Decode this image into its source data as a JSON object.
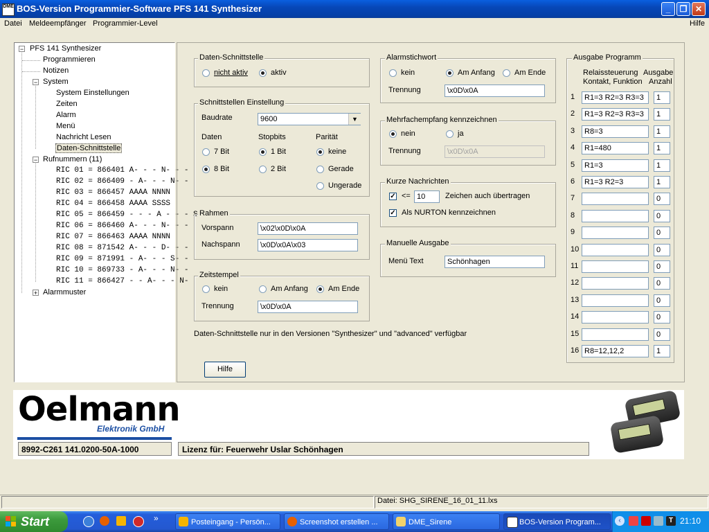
{
  "window": {
    "title": "BOS-Version Programmier-Software PFS 141 Synthesizer",
    "icon": "app-icon",
    "icon_text": "DME"
  },
  "window_controls": {
    "minimize": "_",
    "maximize": "❐",
    "close": "✕"
  },
  "menu": {
    "items": [
      "Datei",
      "Meldeempfänger",
      "Programmier-Level"
    ],
    "help": "Hilfe"
  },
  "tree": {
    "root": "PFS 141 Synthesizer",
    "items": [
      "Programmieren",
      "Notizen"
    ],
    "system": {
      "label": "System",
      "children": [
        "System Einstellungen",
        "Zeiten",
        "Alarm",
        "Menü",
        "Nachricht Lesen",
        "Daten-Schnittstelle"
      ]
    },
    "rufnummern": {
      "label": "Rufnummern (11)",
      "children": [
        "RIC 01 =   866401  A- - -  N- - -",
        "RIC 02 =   866409  - A- -  - N- -",
        "RIC 03 =   866457  AAAA NNNN",
        "RIC 04 =   866458  AAAA SSSS",
        "RIC 05 =   866459  - - - A - - - S",
        "RIC 06 =   866460  A- - -  N- - -",
        "RIC 07 =   866463  AAAA NNNN",
        "RIC 08 =   871542  A- - -  D- - -",
        "RIC 09 =   871991  - A- -  - S- -",
        "RIC 10 =   869733  - A- -  - N- -",
        "RIC 11 =   866427  - - A-  - - N-"
      ]
    },
    "alarmmuster": "Alarmmuster"
  },
  "daten_schnittstelle": {
    "title": "Daten-Schnittstelle",
    "opt1": "nicht aktiv",
    "opt2": "aktiv",
    "selected": "aktiv"
  },
  "schnittstellen": {
    "title": "Schnittstellen Einstellung",
    "baudrate_label": "Baudrate",
    "baudrate": "9600",
    "daten_label": "Daten",
    "daten_opts": [
      "7 Bit",
      "8 Bit"
    ],
    "daten_sel": "8 Bit",
    "stopbits_label": "Stopbits",
    "stopbits_opts": [
      "1 Bit",
      "2 Bit"
    ],
    "stopbits_sel": "1 Bit",
    "paritaet_label": "Parität",
    "paritaet_opts": [
      "keine",
      "Gerade",
      "Ungerade"
    ],
    "paritaet_sel": "keine"
  },
  "rahmen": {
    "title": "Rahmen",
    "vorspann_label": "Vorspann",
    "vorspann": "\\x02\\x0D\\x0A",
    "nachspann_label": "Nachspann",
    "nachspann": "\\x0D\\x0A\\x03"
  },
  "zeitstempel": {
    "title": "Zeitstempel",
    "opts": [
      "kein",
      "Am Anfang",
      "Am Ende"
    ],
    "selected": "Am Ende",
    "trennung_label": "Trennung",
    "trennung": "\\x0D\\x0A"
  },
  "note": "Daten-Schnittstelle nur in den Versionen \"Synthesizer\" und \"advanced\" verfügbar",
  "hilfe_button": "Hilfe",
  "alarmstichwort": {
    "title": "Alarmstichwort",
    "opts": [
      "kein",
      "Am Anfang",
      "Am Ende"
    ],
    "selected": "Am Anfang",
    "trennung_label": "Trennung",
    "trennung": "\\x0D\\x0A"
  },
  "mehrfach": {
    "title": "Mehrfachempfang kennzeichnen",
    "opts": [
      "nein",
      "ja"
    ],
    "selected": "nein",
    "trennung_label": "Trennung",
    "trennung": "\\x0D\\x0A"
  },
  "kurze": {
    "title": "Kurze Nachrichten",
    "le_label": "<=",
    "le_value": "10",
    "suffix": "Zeichen auch übertragen",
    "nurton_label": "Als NURTON kennzeichnen",
    "le_checked": true,
    "nurton_checked": true
  },
  "manuell": {
    "title": "Manuelle Ausgabe",
    "menu_text_label": "Menü Text",
    "menu_text": "Schönhagen"
  },
  "ausgabe": {
    "title": "Ausgabe Programm",
    "col1": [
      "Relaissteuerung",
      "Kontakt, Funktion"
    ],
    "col2": [
      "Ausgabe",
      "Anzahl"
    ],
    "rows": [
      {
        "n": "1",
        "f": "R1=3 R2=3 R3=3",
        "a": "1"
      },
      {
        "n": "2",
        "f": "R1=3 R2=3 R3=3",
        "a": "1"
      },
      {
        "n": "3",
        "f": "R8=3",
        "a": "1"
      },
      {
        "n": "4",
        "f": "R1=480",
        "a": "1"
      },
      {
        "n": "5",
        "f": "R1=3",
        "a": "1"
      },
      {
        "n": "6",
        "f": "R1=3 R2=3",
        "a": "1"
      },
      {
        "n": "7",
        "f": "",
        "a": "0"
      },
      {
        "n": "8",
        "f": "",
        "a": "0"
      },
      {
        "n": "9",
        "f": "",
        "a": "0"
      },
      {
        "n": "10",
        "f": "",
        "a": "0"
      },
      {
        "n": "11",
        "f": "",
        "a": "0"
      },
      {
        "n": "12",
        "f": "",
        "a": "0"
      },
      {
        "n": "13",
        "f": "",
        "a": "0"
      },
      {
        "n": "14",
        "f": "",
        "a": "0"
      },
      {
        "n": "15",
        "f": "",
        "a": "0"
      },
      {
        "n": "16",
        "f": "R8=12,12,2",
        "a": "1"
      }
    ]
  },
  "brand": {
    "logo": "Oelmann",
    "sub": "Elektronik GmbH",
    "logo_color": "#0a0a0a",
    "sub_color": "#1c4fa3",
    "serial": "8992-C261    141.0200-50A-1000",
    "license": "Lizenz für:  Feuerwehr Uslar Schönhagen"
  },
  "status": {
    "file": "Datei: SHG_SIRENE_16_01_11.lxs"
  },
  "taskbar": {
    "start": "Start",
    "tasks": [
      {
        "label": "Posteingang - Persön...",
        "icon": "mail-icon",
        "color": "#f5b400"
      },
      {
        "label": "Screenshot erstellen ...",
        "icon": "firefox-icon",
        "color": "#e66000"
      },
      {
        "label": "DME_Sirene",
        "icon": "folder-icon",
        "color": "#f3d36b"
      },
      {
        "label": "BOS-Version Program...",
        "icon": "app-icon",
        "color": "#ffffff"
      }
    ],
    "clock": "21:10"
  }
}
